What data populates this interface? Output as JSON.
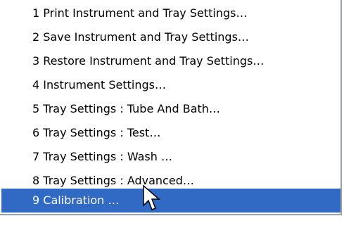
{
  "menu": {
    "items": [
      {
        "label": "1 Print Instrument and Tray Settings…"
      },
      {
        "label": "2 Save Instrument and Tray Settings…"
      },
      {
        "label": "3 Restore Instrument and Tray Settings…"
      },
      {
        "label": "4 Instrument Settings…"
      },
      {
        "label": "5 Tray Settings : Tube And Bath…"
      },
      {
        "label": "6 Tray Settings : Test…"
      },
      {
        "label": "7 Tray Settings : Wash …"
      },
      {
        "label": "8 Tray Settings : Advanced…"
      },
      {
        "label": "9 Calibration …"
      }
    ],
    "selected_index": 8
  },
  "colors": {
    "highlight": "#316ac5",
    "highlight_text": "#ffffff",
    "text": "#000000",
    "shadow": "#9aa3ad"
  },
  "icons": {
    "pointer": "mouse-pointer-icon"
  }
}
